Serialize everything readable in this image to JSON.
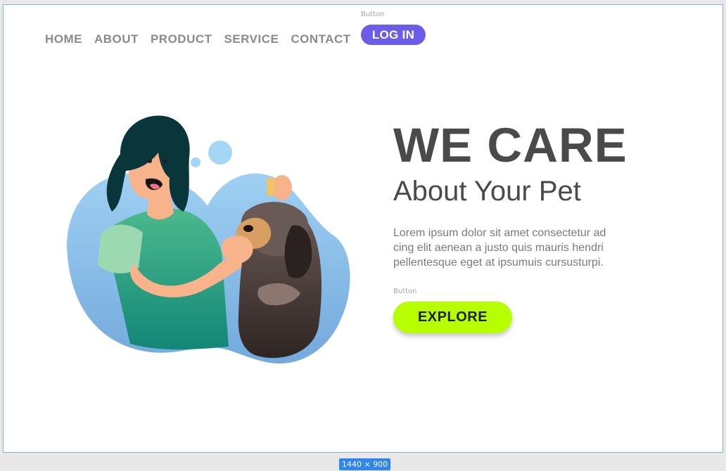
{
  "nav": {
    "items": [
      {
        "label": "HOME"
      },
      {
        "label": "ABOUT"
      },
      {
        "label": "PRODUCT"
      },
      {
        "label": "SERVICE"
      },
      {
        "label": "CONTACT"
      }
    ],
    "login_caption": "Button",
    "login_label": "LOG IN"
  },
  "hero": {
    "title": "WE CARE",
    "subtitle": "About Your Pet",
    "body_lines": [
      "Lorem ipsum dolor sit amet consectetur ad",
      "cing elit aenean a justo quis mauris hendri",
      "pellentesque eget at ipsumuis cursusturpi."
    ],
    "explore_caption": "Button",
    "explore_label": "EXPLORE"
  },
  "artboard": {
    "size_label": "1440 × 900"
  },
  "colors": {
    "login_button": "#6d5ce8",
    "explore_button": "#b7ff00",
    "heading": "#4a4a4a",
    "nav_text": "#8a8a8a",
    "artboard_border": "#7bb6f0",
    "size_badge": "#2f86ef"
  },
  "illustration": {
    "icon": "woman-giving-dog-eye-drops-illustration"
  }
}
